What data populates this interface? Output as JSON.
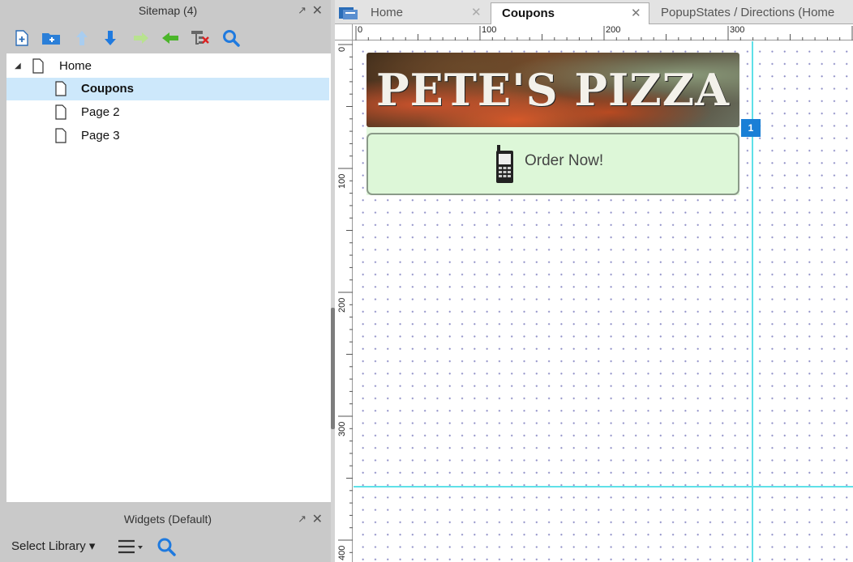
{
  "sitemap": {
    "title": "Sitemap (4)",
    "pin_icon": "↗",
    "close_icon": "✕",
    "toolbar": [
      "add-page-icon",
      "add-folder-icon",
      "move-up-icon",
      "move-down-icon",
      "indent-icon",
      "outdent-icon",
      "delete-icon",
      "search-icon"
    ],
    "tree": [
      {
        "label": "Home",
        "level": 0,
        "expanded": true,
        "selected": false
      },
      {
        "label": "Coupons",
        "level": 1,
        "selected": true
      },
      {
        "label": "Page 2",
        "level": 1,
        "selected": false
      },
      {
        "label": "Page 3",
        "level": 1,
        "selected": false
      }
    ]
  },
  "widgets": {
    "title": "Widgets (Default)",
    "pin_icon": "↗",
    "close_icon": "✕",
    "select_library": "Select Library",
    "dropdown_arrow": "▾"
  },
  "tabs": [
    {
      "label": "Home",
      "close": "✕",
      "active": false
    },
    {
      "label": "Coupons",
      "close": "✕",
      "active": true
    },
    {
      "label": "PopupStates / Directions (Home",
      "active": false
    }
  ],
  "rulers": {
    "top": [
      "0",
      "100",
      "200",
      "300"
    ],
    "left": [
      "0",
      "100",
      "200",
      "300",
      "400"
    ]
  },
  "page": {
    "banner_title": "PETE'S PIZZA",
    "order_button": "Order Now!",
    "marker": "1"
  },
  "colors": {
    "selection": "#cde8fb",
    "guide": "#5fe0e8",
    "button_fill": "#ddf7d8",
    "marker": "#1a7fd6"
  }
}
